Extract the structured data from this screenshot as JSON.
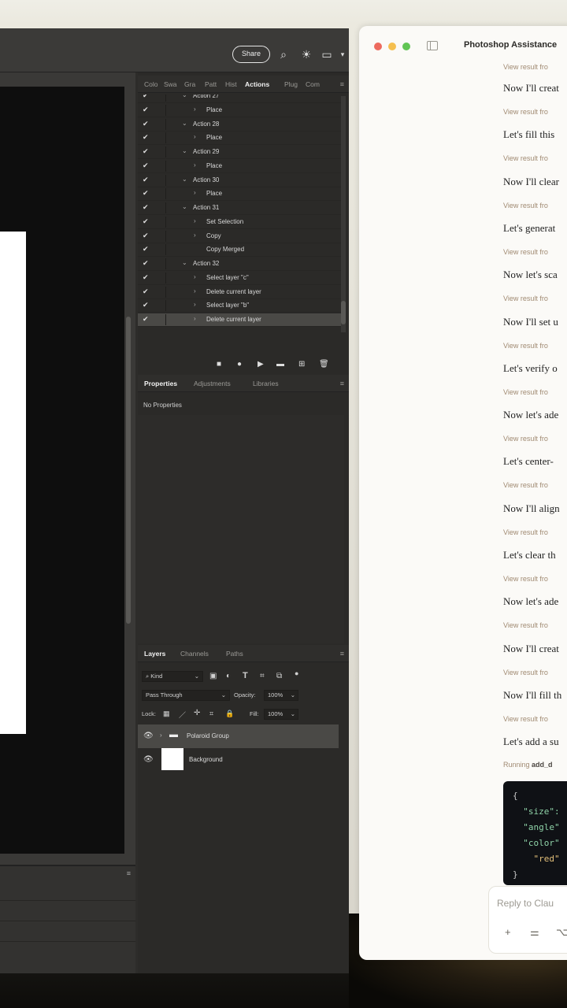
{
  "photoshop": {
    "share_label": "Share",
    "actions_panel": {
      "tabs": [
        "Colo",
        "Swa",
        "Gra",
        "Patt",
        "Hist",
        "Actions",
        "Plug",
        "Com"
      ],
      "active_tab": "Actions",
      "items": [
        {
          "label": "Action 27",
          "level": "action",
          "open": true
        },
        {
          "label": "Place",
          "level": "step"
        },
        {
          "label": "Action 28",
          "level": "action",
          "open": true
        },
        {
          "label": "Place",
          "level": "step"
        },
        {
          "label": "Action 29",
          "level": "action",
          "open": true
        },
        {
          "label": "Place",
          "level": "step"
        },
        {
          "label": "Action 30",
          "level": "action",
          "open": true
        },
        {
          "label": "Place",
          "level": "step"
        },
        {
          "label": "Action 31",
          "level": "action",
          "open": true
        },
        {
          "label": "Set Selection",
          "level": "step"
        },
        {
          "label": "Copy",
          "level": "step"
        },
        {
          "label": "Copy Merged",
          "level": "step",
          "no_chevron": true
        },
        {
          "label": "Action 32",
          "level": "action",
          "open": true
        },
        {
          "label": "Select layer \"c\"",
          "level": "step"
        },
        {
          "label": "Delete current layer",
          "level": "step"
        },
        {
          "label": "Select layer \"b\"",
          "level": "step"
        },
        {
          "label": "Delete current layer",
          "level": "step",
          "selected": true
        }
      ]
    },
    "properties_panel": {
      "tabs": [
        "Properties",
        "Adjustments",
        "Libraries"
      ],
      "active_tab": "Properties",
      "empty_text": "No Properties"
    },
    "layers_panel": {
      "tabs": [
        "Layers",
        "Channels",
        "Paths"
      ],
      "active_tab": "Layers",
      "filter_kind": "Kind",
      "blend_mode": "Pass Through",
      "opacity_label": "Opacity:",
      "opacity_value": "100%",
      "lock_label": "Lock:",
      "fill_label": "Fill:",
      "fill_value": "100%",
      "layers": [
        {
          "name": "Polaroid Group",
          "type": "group",
          "selected": true
        },
        {
          "name": "Background",
          "type": "pixel"
        }
      ]
    }
  },
  "claude": {
    "title": "Photoshop Assistance",
    "messages": [
      {
        "text": "Now I'll creat",
        "link": "View result fro"
      },
      {
        "text": "Let's fill this",
        "link": "View result fro"
      },
      {
        "text": "Now I'll clear",
        "link": "View result fro"
      },
      {
        "text": "Let's generat",
        "link": "View result fro"
      },
      {
        "text": "Now let's sca",
        "link": "View result fro"
      },
      {
        "text": "Now I'll set u",
        "link": "View result fro"
      },
      {
        "text": "Let's verify o",
        "link": "View result fro"
      },
      {
        "text": "Now let's ade",
        "link": "View result fro"
      },
      {
        "text": "Let's center-",
        "link": "View result fro"
      },
      {
        "text": "Now I'll align",
        "link": "View result fro"
      },
      {
        "text": "Let's clear th",
        "link": "View result fro"
      },
      {
        "text": "Now let's ade",
        "link": "View result fro"
      },
      {
        "text": "Now I'll creat",
        "link": "View result fro"
      },
      {
        "text": "Now I'll fill th",
        "link": "View result fro"
      },
      {
        "text": "Let's add a su",
        "link": ""
      }
    ],
    "first_link": "View result fro",
    "running_prefix": "Running",
    "running_tool": "add_d",
    "code_lines": [
      "{",
      "  \"size\":",
      "  \"angle\"",
      "  \"color\"",
      "    \"red\"",
      "}"
    ],
    "composer_placeholder": "Reply to Clau"
  }
}
